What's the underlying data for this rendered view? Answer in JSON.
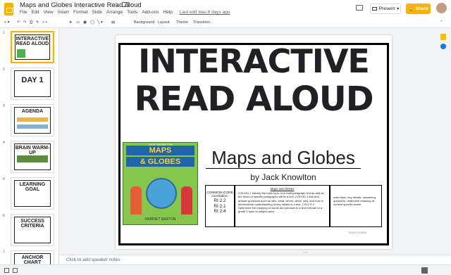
{
  "app": {
    "title": "Maps and Globes Interactive Read Aloud",
    "menu": [
      "File",
      "Edit",
      "View",
      "Insert",
      "Format",
      "Slide",
      "Arrange",
      "Tools",
      "Add-ons",
      "Help"
    ],
    "last_edit": "Last edit was 8 days ago",
    "present_label": "Present",
    "share_label": "Share"
  },
  "toolbar": {
    "background_label": "Background",
    "layout_label": "Layout",
    "theme_label": "Theme",
    "transition_label": "Transition"
  },
  "thumbnails": [
    {
      "num": "1",
      "title": "INTERACTIVE READ ALOUD"
    },
    {
      "num": "2",
      "title": "DAY 1"
    },
    {
      "num": "3",
      "title": "AGENDA"
    },
    {
      "num": "4",
      "title": "BRAIN WARM-UP"
    },
    {
      "num": "5",
      "title": "LEARNING GOAL"
    },
    {
      "num": "6",
      "title": "SUCCESS CRITERIA"
    },
    {
      "num": "7",
      "title": "ANCHOR CHART"
    }
  ],
  "slide": {
    "title_line1": "INTERACTIVE",
    "title_line2": "READ ALOUD",
    "subtitle": "Maps and Globes",
    "byline": "by Jack Knowlton",
    "book": {
      "top_author": "JACK KNOWLTON",
      "title1": "MAPS",
      "title2": "& GLOBES",
      "author": "HARRIET BARTON"
    },
    "standards_label": "COMMON CORE correlation:",
    "codes": [
      "RI 2.2",
      "RI 2.1",
      "RI 2.4"
    ],
    "box_heading": "Maps and Globes",
    "box_text": "2.RI.KID.2 Identify the main topic of a multi-paragraph text as well as the focus of specific paragraphs within a text. 2.RI.KID.1 Ask and answer questions such as who, what, where, when, why, and how to demonstrate understanding of key details in a text. 2.RI.CS.4 Determine the meaning of words and phrases in a text relevant to a grade 2 topic or subject area.",
    "right_text": "main topic, key details, answering questions, determine meaning of content specific words",
    "credit": "TEACH COWAN"
  },
  "notes_placeholder": "Click to add speaker notes"
}
